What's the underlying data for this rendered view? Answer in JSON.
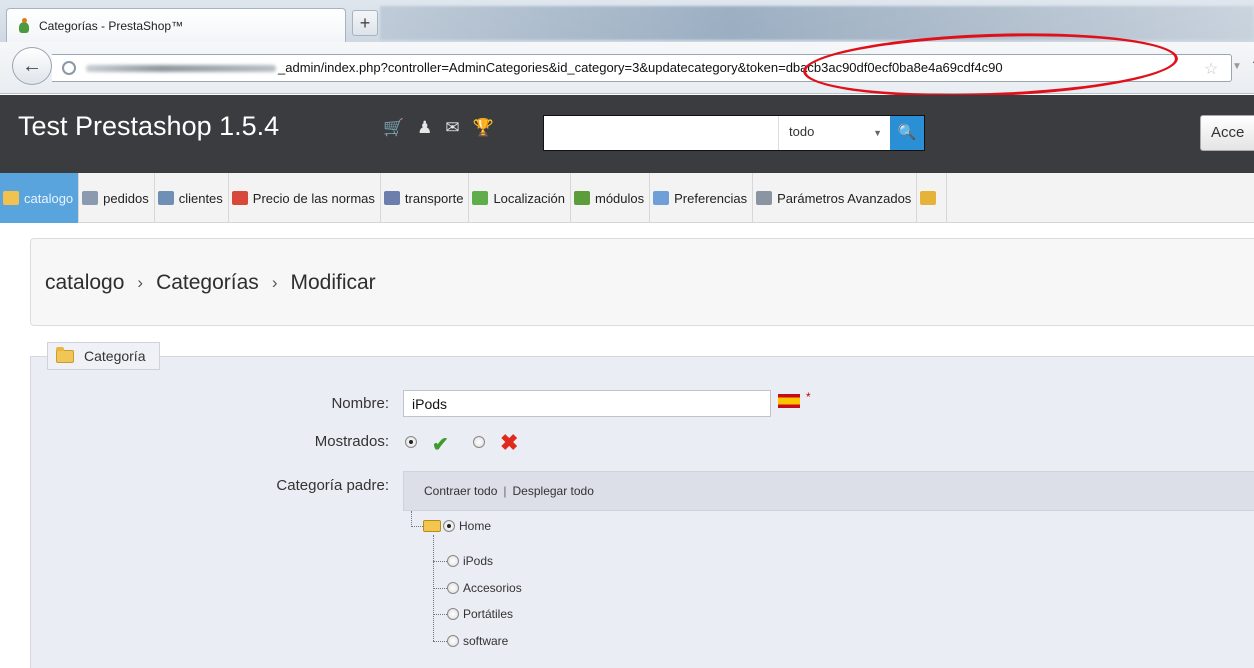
{
  "browser": {
    "tab_title": "Categorías - PrestaShop™",
    "new_tab": "+",
    "url": "_admin/index.php?controller=AdminCategories&id_category=3&updatecategory&token=dbacb3ac90df0ecf0ba8e4a69cdf4c90"
  },
  "header": {
    "shop_name": "Test Prestashop 1.5.4",
    "search": {
      "value": "",
      "scope": "todo"
    },
    "access_button": "Acce"
  },
  "menu": [
    {
      "key": "catalogo",
      "label": "catalogo",
      "active": true,
      "icon": "folder-icon",
      "color": "#f1c24d"
    },
    {
      "key": "pedidos",
      "label": "pedidos",
      "active": false,
      "icon": "cart-icon",
      "color": "#8a9bb0"
    },
    {
      "key": "clientes",
      "label": "clientes",
      "active": false,
      "icon": "user-icon",
      "color": "#6f8fb4"
    },
    {
      "key": "precio",
      "label": "Precio de las normas",
      "active": false,
      "icon": "price-rule-icon",
      "color": "#d9473b"
    },
    {
      "key": "transporte",
      "label": "transporte",
      "active": false,
      "icon": "truck-icon",
      "color": "#6c7eab"
    },
    {
      "key": "localizacion",
      "label": "Localización",
      "active": false,
      "icon": "globe-icon",
      "color": "#5fae4b"
    },
    {
      "key": "modulos",
      "label": "módulos",
      "active": false,
      "icon": "puzzle-icon",
      "color": "#5c9c3b"
    },
    {
      "key": "preferencias",
      "label": "Preferencias",
      "active": false,
      "icon": "preferences-icon",
      "color": "#6e9fd8"
    },
    {
      "key": "parametros",
      "label": "Parámetros Avanzados",
      "active": false,
      "icon": "wrench-icon",
      "color": "#8a94a3"
    }
  ],
  "breadcrumb": [
    "catalogo",
    "Categorías",
    "Modificar"
  ],
  "breadcrumb_sep": "›",
  "form": {
    "legend": "Categoría",
    "nombre_label": "Nombre:",
    "nombre_value": "iPods",
    "required_mark": "*",
    "mostrados_label": "Mostrados:",
    "parent_label": "Categoría padre:",
    "collapse_all": "Contraer todo",
    "separator": "|",
    "expand_all": "Desplegar todo",
    "tree": {
      "root": "Home",
      "children": [
        "iPods",
        "Accesorios",
        "Portátiles",
        "software"
      ]
    }
  }
}
